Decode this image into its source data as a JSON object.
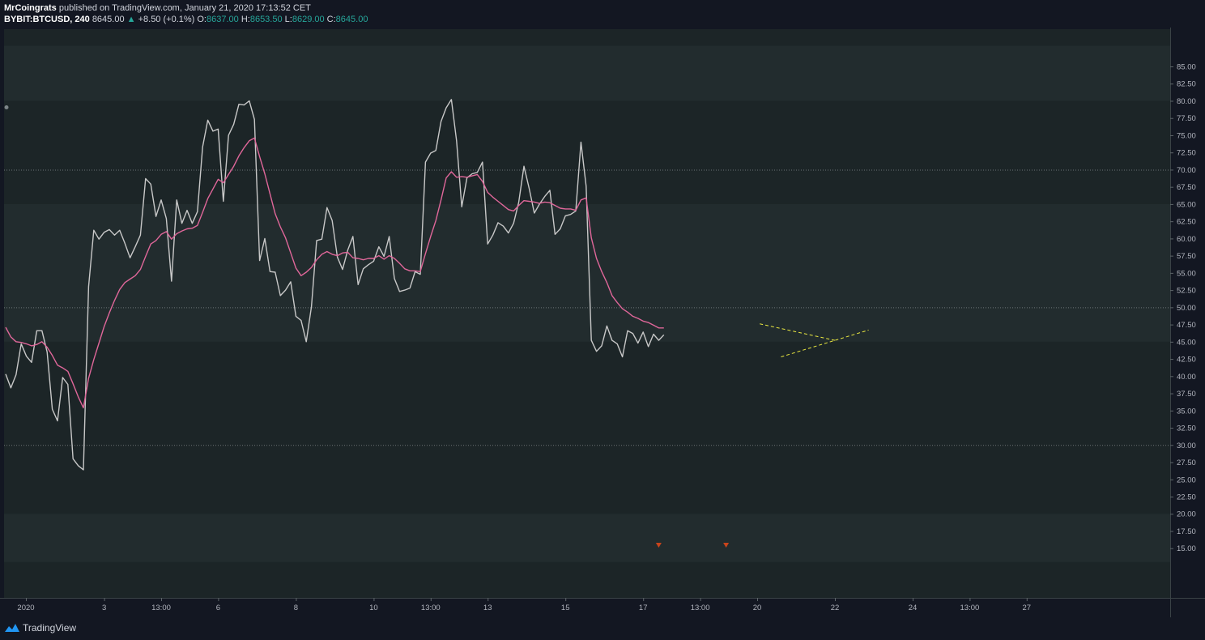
{
  "header": {
    "author": "MrCoingrats",
    "published_text": "published on TradingView.com, January 21, 2020 17:13:52 CET",
    "symbol": "BYBIT:BTCUSD, 240",
    "last_price": "8645.00",
    "change_arrow": "▲",
    "change": "+8.50 (+0.1%)",
    "o_label": "O:",
    "o_value": "8637.00",
    "h_label": "H:",
    "h_value": "8653.50",
    "l_label": "L:",
    "l_value": "8629.00",
    "c_label": "C:",
    "c_value": "8645.00"
  },
  "footer": {
    "brand": "TradingView"
  },
  "colors": {
    "background": "#1c2527",
    "band": "#222c2e",
    "oscillator": "#c8c8c8",
    "moving_average": "#e0679a",
    "trendline": "#e8e640",
    "marker": "#c9441b",
    "accent_green": "#26a69a"
  },
  "chart_data": {
    "type": "line",
    "ylim": [
      13,
      88
    ],
    "y_ticks": [
      "85.00",
      "82.50",
      "80.00",
      "77.50",
      "75.00",
      "72.50",
      "70.00",
      "67.50",
      "65.00",
      "62.50",
      "60.00",
      "57.50",
      "55.00",
      "52.50",
      "50.00",
      "47.50",
      "45.00",
      "42.50",
      "40.00",
      "37.50",
      "35.00",
      "32.50",
      "30.00",
      "27.50",
      "25.00",
      "22.50",
      "20.00",
      "17.50",
      "15.00"
    ],
    "x_tick_labels": [
      {
        "label": "2020",
        "bar": 4
      },
      {
        "label": "3",
        "bar": 19
      },
      {
        "label": "13:00",
        "bar": 30
      },
      {
        "label": "6",
        "bar": 41
      },
      {
        "label": "8",
        "bar": 56
      },
      {
        "label": "10",
        "bar": 71
      },
      {
        "label": "13:00",
        "bar": 82
      },
      {
        "label": "13",
        "bar": 93
      },
      {
        "label": "15",
        "bar": 108
      },
      {
        "label": "17",
        "bar": 123
      },
      {
        "label": "13:00",
        "bar": 134
      },
      {
        "label": "20",
        "bar": 145
      },
      {
        "label": "22",
        "bar": 160
      },
      {
        "label": "24",
        "bar": 175
      },
      {
        "label": "13:00",
        "bar": 186
      },
      {
        "label": "27",
        "bar": 197
      }
    ],
    "bands": [
      {
        "from": 80,
        "to": 88
      },
      {
        "from": 45,
        "to": 65
      },
      {
        "from": 13,
        "to": 20
      }
    ],
    "dotted_levels": [
      70,
      50,
      30
    ],
    "series": [
      {
        "values": [
          40.3,
          38.3,
          40.2,
          44.7,
          42.9,
          42.0,
          46.6,
          46.6,
          43.5,
          35.2,
          33.5,
          39.8,
          38.8,
          28.0,
          27.0,
          26.4,
          53.0,
          61.2,
          59.9,
          60.9,
          61.3,
          60.5,
          61.2,
          59.3,
          57.2,
          58.8,
          60.5,
          68.7,
          67.9,
          63.2,
          65.6,
          62.9,
          53.8,
          65.6,
          62.2,
          64.1,
          62.2,
          63.9,
          73.3,
          77.2,
          75.6,
          75.9,
          65.4,
          75.0,
          76.6,
          79.5,
          79.4,
          80.0,
          77.3,
          56.8,
          60.0,
          55.2,
          55.1,
          51.7,
          52.5,
          53.7,
          48.7,
          48.1,
          45.0,
          50.1,
          59.7,
          59.9,
          64.5,
          62.6,
          57.3,
          55.5,
          58.3,
          60.3,
          53.3,
          55.6,
          56.2,
          56.7,
          58.8,
          57.4,
          60.3,
          54.2,
          52.3,
          52.5,
          52.8,
          55.2,
          54.8,
          71.1,
          72.4,
          72.8,
          77.0,
          79.0,
          80.2,
          74.2,
          64.6,
          68.8,
          69.4,
          69.6,
          71.1,
          59.2,
          60.5,
          62.3,
          61.8,
          60.8,
          62.2,
          65.3,
          70.5,
          67.3,
          63.7,
          65.0,
          66.1,
          67.0,
          60.6,
          61.4,
          63.3,
          63.5,
          64.0,
          74.0,
          67.6,
          45.2,
          43.6,
          44.4,
          47.3,
          45.2,
          44.7,
          42.8,
          46.6,
          46.2,
          44.8,
          46.4,
          44.3,
          46.1,
          45.2,
          46.0
        ],
        "color": "#c8c8c8"
      },
      {
        "values": [
          47.1,
          45.7,
          45.0,
          44.9,
          44.7,
          44.4,
          44.6,
          45.0,
          44.2,
          43.0,
          41.6,
          41.2,
          40.7,
          38.9,
          37.0,
          35.4,
          39.7,
          42.4,
          44.8,
          47.2,
          49.2,
          51.0,
          52.6,
          53.6,
          54.1,
          54.6,
          55.5,
          57.4,
          59.2,
          59.7,
          60.6,
          61.0,
          59.9,
          60.7,
          61.1,
          61.4,
          61.5,
          61.9,
          63.8,
          65.8,
          67.2,
          68.6,
          68.1,
          69.3,
          70.5,
          72.0,
          73.2,
          74.2,
          74.6,
          71.9,
          69.4,
          66.5,
          63.6,
          61.7,
          60.1,
          57.9,
          55.7,
          54.6,
          55.1,
          55.8,
          56.9,
          57.7,
          58.1,
          57.7,
          57.5,
          57.9,
          58.0,
          57.2,
          57.1,
          56.9,
          57.1,
          57.1,
          57.5,
          57.0,
          57.5,
          57.1,
          56.4,
          55.6,
          55.3,
          55.3,
          55.2,
          57.8,
          60.3,
          62.6,
          65.6,
          68.8,
          69.7,
          68.9,
          69.0,
          68.9,
          69.1,
          69.3,
          68.3,
          66.7,
          66.0,
          65.4,
          64.8,
          64.2,
          64.0,
          64.8,
          65.5,
          65.4,
          65.3,
          65.1,
          65.3,
          65.2,
          64.8,
          64.4,
          64.3,
          64.3,
          64.1,
          65.6,
          65.9,
          60.1,
          57.1,
          55.2,
          53.6,
          51.7,
          50.7,
          49.8,
          49.3,
          48.7,
          48.4,
          48.0,
          47.8,
          47.4,
          47.0,
          47.0
        ],
        "color": "#e0679a"
      }
    ],
    "trendlines": [
      {
        "x1": 145.5,
        "y1": 47.6,
        "x2": 160.0,
        "y2": 45.2
      },
      {
        "x1": 149.6,
        "y1": 42.8,
        "x2": 166.5,
        "y2": 46.7
      }
    ],
    "markers": [
      {
        "bar": 126
      },
      {
        "bar": 139
      }
    ]
  }
}
